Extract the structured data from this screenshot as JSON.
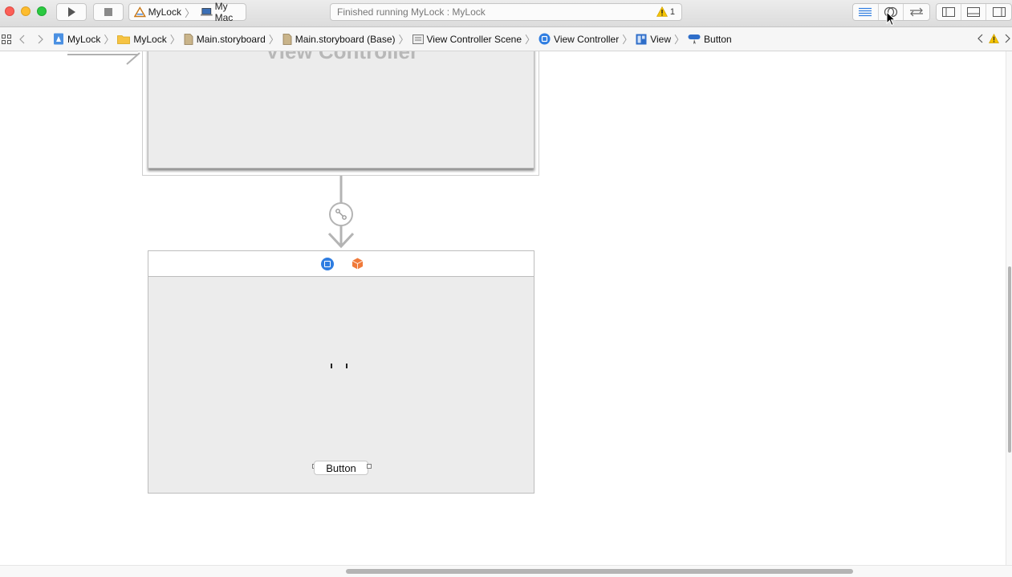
{
  "toolbar": {
    "run_icon": "play-icon",
    "stop_icon": "stop-icon",
    "scheme": {
      "target": "MyLock",
      "destination": "My Mac"
    },
    "activity": {
      "status": "Finished running MyLock : MyLock",
      "warning_count": "1"
    },
    "editor_modes": [
      "standard-editor-icon",
      "assistant-editor-icon",
      "version-editor-icon"
    ],
    "panels": [
      "navigator-toggle-icon",
      "debug-toggle-icon",
      "utilities-toggle-icon"
    ]
  },
  "jumpbar": {
    "crumbs": [
      {
        "label": "MyLock",
        "icon": "project-icon"
      },
      {
        "label": "MyLock",
        "icon": "folder-icon"
      },
      {
        "label": "Main.storyboard",
        "icon": "storyboard-icon"
      },
      {
        "label": "Main.storyboard (Base)",
        "icon": "storyboard-icon"
      },
      {
        "label": "View Controller Scene",
        "icon": "scene-icon"
      },
      {
        "label": "View Controller",
        "icon": "view-controller-icon"
      },
      {
        "label": "View",
        "icon": "view-icon"
      },
      {
        "label": "Button",
        "icon": "button-icon"
      }
    ]
  },
  "canvas": {
    "scene_title": "View Controller",
    "button_label": "Button"
  },
  "colors": {
    "accent": "#2f7de1",
    "warning": "#f5c400",
    "scene_bg": "#ececec",
    "cube": "#f07a3a"
  }
}
